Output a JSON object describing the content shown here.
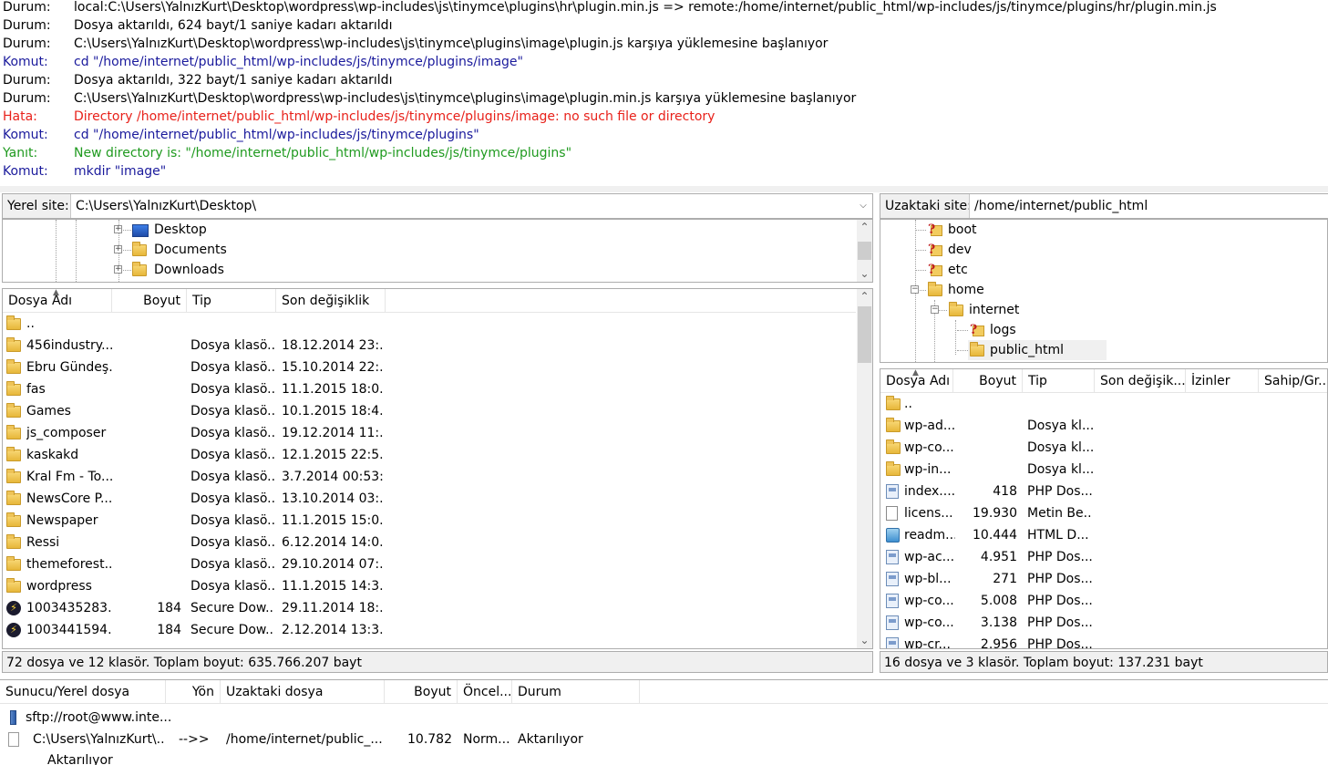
{
  "log": [
    {
      "type": "Durum:",
      "kind": "status",
      "msg": "local:C:\\Users\\YalnızKurt\\Desktop\\wordpress\\wp-includes\\js\\tinymce\\plugins\\hr\\plugin.min.js => remote:/home/internet/public_html/wp-includes/js/tinymce/plugins/hr/plugin.min.js"
    },
    {
      "type": "Durum:",
      "kind": "status",
      "msg": "Dosya aktarıldı, 624 bayt/1 saniye kadarı aktarıldı"
    },
    {
      "type": "Durum:",
      "kind": "status",
      "msg": "C:\\Users\\YalnızKurt\\Desktop\\wordpress\\wp-includes\\js\\tinymce\\plugins\\image\\plugin.js karşıya yüklemesine başlanıyor"
    },
    {
      "type": "Komut:",
      "kind": "cmd",
      "msg": "cd \"/home/internet/public_html/wp-includes/js/tinymce/plugins/image\""
    },
    {
      "type": "Durum:",
      "kind": "status",
      "msg": "Dosya aktarıldı, 322 bayt/1 saniye kadarı aktarıldı"
    },
    {
      "type": "Durum:",
      "kind": "status",
      "msg": "C:\\Users\\YalnızKurt\\Desktop\\wordpress\\wp-includes\\js\\tinymce\\plugins\\image\\plugin.min.js karşıya yüklemesine başlanıyor"
    },
    {
      "type": "Hata:",
      "kind": "err",
      "msg": "Directory /home/internet/public_html/wp-includes/js/tinymce/plugins/image: no such file or directory"
    },
    {
      "type": "Komut:",
      "kind": "cmd",
      "msg": "cd \"/home/internet/public_html/wp-includes/js/tinymce/plugins\""
    },
    {
      "type": "Yanıt:",
      "kind": "resp",
      "msg": "New directory is: \"/home/internet/public_html/wp-includes/js/tinymce/plugins\""
    },
    {
      "type": "Komut:",
      "kind": "cmd",
      "msg": "mkdir \"image\""
    }
  ],
  "local": {
    "site_label": "Yerel site:",
    "path": "C:\\Users\\YalnızKurt\\Desktop\\",
    "tree": [
      "Desktop",
      "Documents",
      "Downloads"
    ],
    "columns": {
      "name": "Dosya Adı",
      "size": "Boyut",
      "type": "Tip",
      "modified": "Son değişiklik"
    },
    "files": [
      {
        "icon": "folder",
        "name": "..",
        "size": "",
        "type": "",
        "modified": ""
      },
      {
        "icon": "folder",
        "name": "456industry...",
        "size": "",
        "type": "Dosya klasö...",
        "modified": "18.12.2014 23:..."
      },
      {
        "icon": "folder",
        "name": "Ebru Gündeş...",
        "size": "",
        "type": "Dosya klasö...",
        "modified": "15.10.2014 22:..."
      },
      {
        "icon": "folder",
        "name": "fas",
        "size": "",
        "type": "Dosya klasö...",
        "modified": "11.1.2015 18:0..."
      },
      {
        "icon": "folder",
        "name": "Games",
        "size": "",
        "type": "Dosya klasö...",
        "modified": "10.1.2015 18:4..."
      },
      {
        "icon": "folder",
        "name": "js_composer",
        "size": "",
        "type": "Dosya klasö...",
        "modified": "19.12.2014 11:..."
      },
      {
        "icon": "folder",
        "name": "kaskakd",
        "size": "",
        "type": "Dosya klasö...",
        "modified": "12.1.2015 22:5..."
      },
      {
        "icon": "folder",
        "name": "Kral Fm - To...",
        "size": "",
        "type": "Dosya klasö...",
        "modified": "3.7.2014 00:53:..."
      },
      {
        "icon": "folder",
        "name": "NewsCore P...",
        "size": "",
        "type": "Dosya klasö...",
        "modified": "13.10.2014 03:..."
      },
      {
        "icon": "folder",
        "name": "Newspaper",
        "size": "",
        "type": "Dosya klasö...",
        "modified": "11.1.2015 15:0..."
      },
      {
        "icon": "folder",
        "name": "Ressi",
        "size": "",
        "type": "Dosya klasö...",
        "modified": "6.12.2014 14:0..."
      },
      {
        "icon": "folder",
        "name": "themeforest...",
        "size": "",
        "type": "Dosya klasö...",
        "modified": "29.10.2014 07:..."
      },
      {
        "icon": "folder",
        "name": "wordpress",
        "size": "",
        "type": "Dosya klasö...",
        "modified": "11.1.2015 14:3..."
      },
      {
        "icon": "bolt",
        "name": "1003435283...",
        "size": "184",
        "type": "Secure Dow...",
        "modified": "29.11.2014 18:..."
      },
      {
        "icon": "bolt",
        "name": "1003441594...",
        "size": "184",
        "type": "Secure Dow...",
        "modified": "2.12.2014 13:3..."
      }
    ],
    "status": "72 dosya ve 12 klasör. Toplam boyut: 635.766.207 bayt"
  },
  "remote": {
    "site_label": "Uzaktaki site:",
    "path": "/home/internet/public_html",
    "tree": [
      "boot",
      "dev",
      "etc",
      "home",
      "internet",
      "logs",
      "public_html"
    ],
    "columns": {
      "name": "Dosya Adı",
      "size": "Boyut",
      "type": "Tip",
      "modified": "Son değişik...",
      "perms": "İzinler",
      "owner": "Sahip/Gr..."
    },
    "files": [
      {
        "icon": "folder",
        "name": "..",
        "size": "",
        "type": ""
      },
      {
        "icon": "folder",
        "name": "wp-ad...",
        "size": "",
        "type": "Dosya kl..."
      },
      {
        "icon": "folder",
        "name": "wp-co...",
        "size": "",
        "type": "Dosya kl..."
      },
      {
        "icon": "folder",
        "name": "wp-in...",
        "size": "",
        "type": "Dosya kl..."
      },
      {
        "icon": "php",
        "name": "index....",
        "size": "418",
        "type": "PHP Dos..."
      },
      {
        "icon": "doc",
        "name": "licens...",
        "size": "19.930",
        "type": "Metin Be..."
      },
      {
        "icon": "html",
        "name": "readm...",
        "size": "10.444",
        "type": "HTML D..."
      },
      {
        "icon": "php",
        "name": "wp-ac...",
        "size": "4.951",
        "type": "PHP Dos..."
      },
      {
        "icon": "php",
        "name": "wp-bl...",
        "size": "271",
        "type": "PHP Dos..."
      },
      {
        "icon": "php",
        "name": "wp-co...",
        "size": "5.008",
        "type": "PHP Dos..."
      },
      {
        "icon": "php",
        "name": "wp-co...",
        "size": "3.138",
        "type": "PHP Dos..."
      },
      {
        "icon": "php",
        "name": "wp-cr...",
        "size": "2.956",
        "type": "PHP Dos..."
      }
    ],
    "status": "16 dosya ve 3 klasör. Toplam boyut: 137.231 bayt"
  },
  "queue": {
    "columns": {
      "server": "Sunucu/Yerel dosya",
      "direction": "Yön",
      "remote": "Uzaktaki dosya",
      "size": "Boyut",
      "priority": "Öncel...",
      "status": "Durum"
    },
    "server_row": "sftp://root@www.inte...",
    "item": {
      "local": "C:\\Users\\YalnızKurt\\...",
      "direction": "-->>",
      "remote": "/home/internet/public_...",
      "size": "10.782",
      "priority": "Norm...",
      "status": "Aktarılıyor"
    },
    "sub_status": "Aktarılıyor"
  }
}
